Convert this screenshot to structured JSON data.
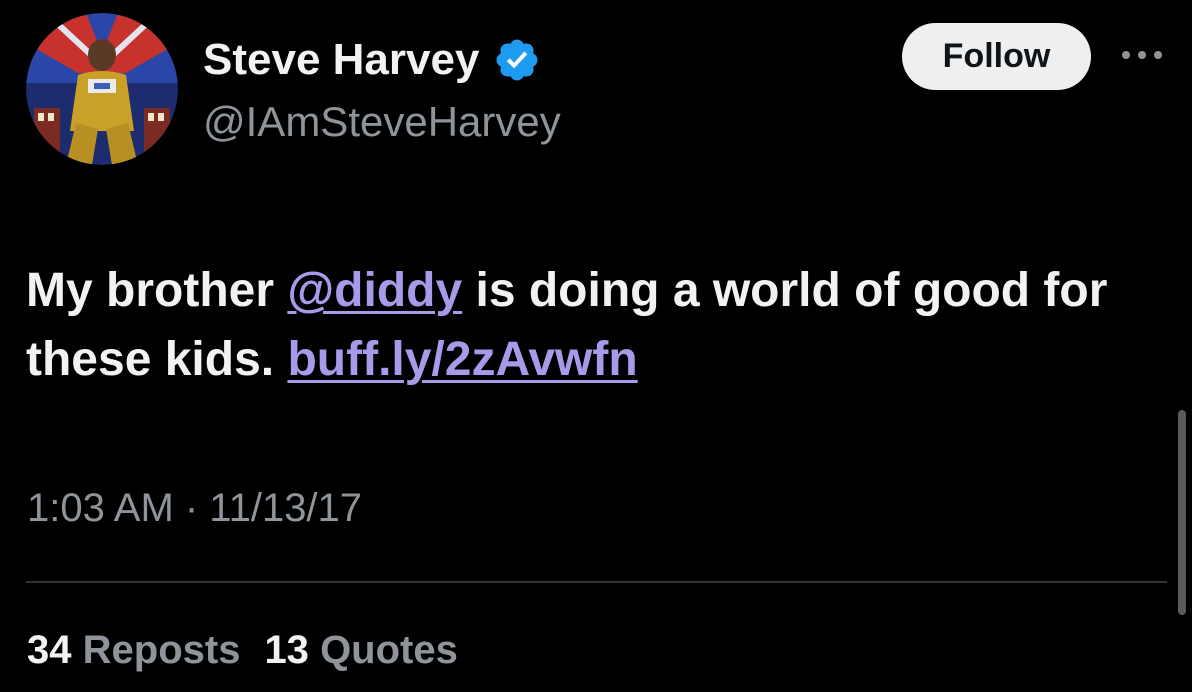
{
  "author": {
    "display_name": "Steve Harvey",
    "handle": "@IAmSteveHarvey",
    "verified_icon": "verified-badge-icon",
    "verified_color": "#1d9bf0"
  },
  "header": {
    "follow_label": "Follow",
    "more_icon": "more-horizontal-icon"
  },
  "tweet": {
    "text_before_mention": "My brother ",
    "mention": "@diddy",
    "text_after_mention": " is doing a world of good for these kids. ",
    "link": "buff.ly/2zAvwfn",
    "link_color": "#a59be8"
  },
  "meta": {
    "timestamp": "1:03 AM · 11/13/17"
  },
  "stats": {
    "reposts_count": "34",
    "reposts_label": "Reposts",
    "quotes_count": "13",
    "quotes_label": "Quotes"
  }
}
